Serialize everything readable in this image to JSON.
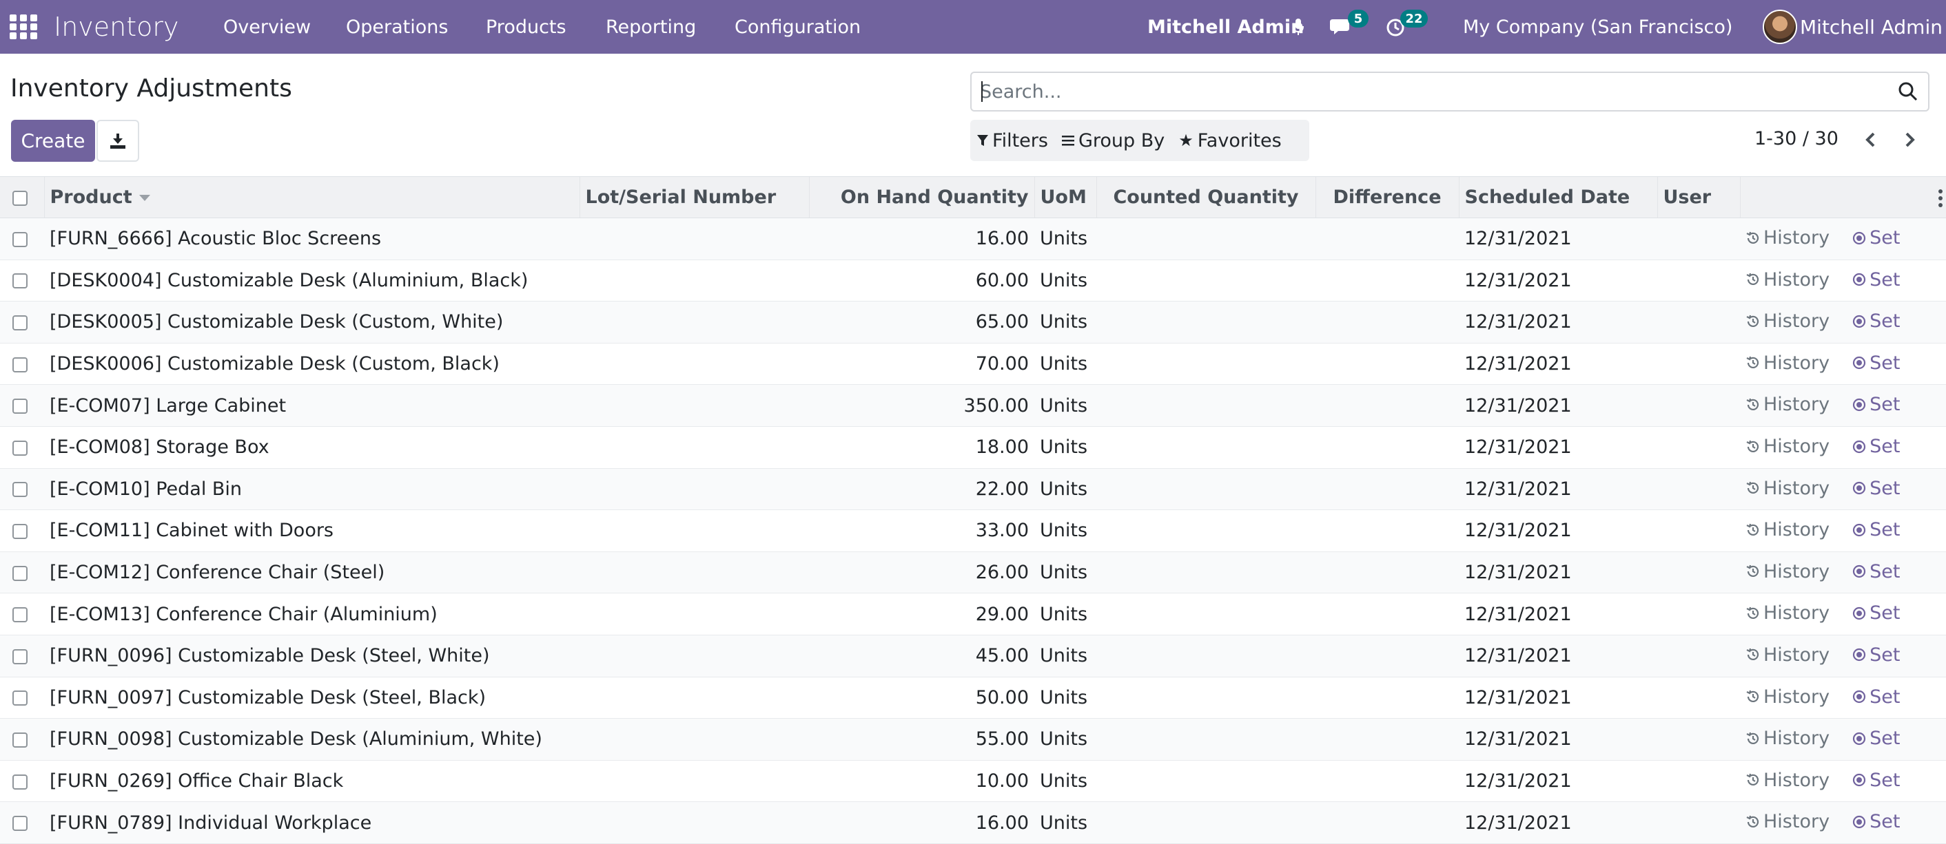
{
  "navbar": {
    "app_name": "Inventory",
    "menu": [
      "Overview",
      "Operations",
      "Products",
      "Reporting",
      "Configuration"
    ],
    "systray_user": "Mitchell Admin",
    "messages_count": "5",
    "activities_count": "22",
    "company": "My Company (San Francisco)",
    "user_name": "Mitchell Admin"
  },
  "control_panel": {
    "title": "Inventory Adjustments",
    "create_label": "Create",
    "search_placeholder": "Search...",
    "filters_label": "Filters",
    "groupby_label": "Group By",
    "favorites_label": "Favorites",
    "pager": "1-30 / 30"
  },
  "columns": {
    "product": "Product",
    "lot": "Lot/Serial Number",
    "on_hand": "On Hand Quantity",
    "uom": "UoM",
    "counted": "Counted Quantity",
    "difference": "Difference",
    "scheduled": "Scheduled Date",
    "user": "User"
  },
  "row_actions": {
    "history": "History",
    "set": "Set"
  },
  "rows": [
    {
      "product": "[FURN_6666] Acoustic Bloc Screens",
      "qty": "16.00",
      "uom": "Units",
      "date": "12/31/2021"
    },
    {
      "product": "[DESK0004] Customizable Desk (Aluminium, Black)",
      "qty": "60.00",
      "uom": "Units",
      "date": "12/31/2021"
    },
    {
      "product": "[DESK0005] Customizable Desk (Custom, White)",
      "qty": "65.00",
      "uom": "Units",
      "date": "12/31/2021"
    },
    {
      "product": "[DESK0006] Customizable Desk (Custom, Black)",
      "qty": "70.00",
      "uom": "Units",
      "date": "12/31/2021"
    },
    {
      "product": "[E-COM07] Large Cabinet",
      "qty": "350.00",
      "uom": "Units",
      "date": "12/31/2021"
    },
    {
      "product": "[E-COM08] Storage Box",
      "qty": "18.00",
      "uom": "Units",
      "date": "12/31/2021"
    },
    {
      "product": "[E-COM10] Pedal Bin",
      "qty": "22.00",
      "uom": "Units",
      "date": "12/31/2021"
    },
    {
      "product": "[E-COM11] Cabinet with Doors",
      "qty": "33.00",
      "uom": "Units",
      "date": "12/31/2021"
    },
    {
      "product": "[E-COM12] Conference Chair (Steel)",
      "qty": "26.00",
      "uom": "Units",
      "date": "12/31/2021"
    },
    {
      "product": "[E-COM13] Conference Chair (Aluminium)",
      "qty": "29.00",
      "uom": "Units",
      "date": "12/31/2021"
    },
    {
      "product": "[FURN_0096] Customizable Desk (Steel, White)",
      "qty": "45.00",
      "uom": "Units",
      "date": "12/31/2021"
    },
    {
      "product": "[FURN_0097] Customizable Desk (Steel, Black)",
      "qty": "50.00",
      "uom": "Units",
      "date": "12/31/2021"
    },
    {
      "product": "[FURN_0098] Customizable Desk (Aluminium, White)",
      "qty": "55.00",
      "uom": "Units",
      "date": "12/31/2021"
    },
    {
      "product": "[FURN_0269] Office Chair Black",
      "qty": "10.00",
      "uom": "Units",
      "date": "12/31/2021"
    },
    {
      "product": "[FURN_0789] Individual Workplace",
      "qty": "16.00",
      "uom": "Units",
      "date": "12/31/2021"
    }
  ],
  "colors": {
    "brand": "#71639e",
    "badge": "#017e84"
  }
}
